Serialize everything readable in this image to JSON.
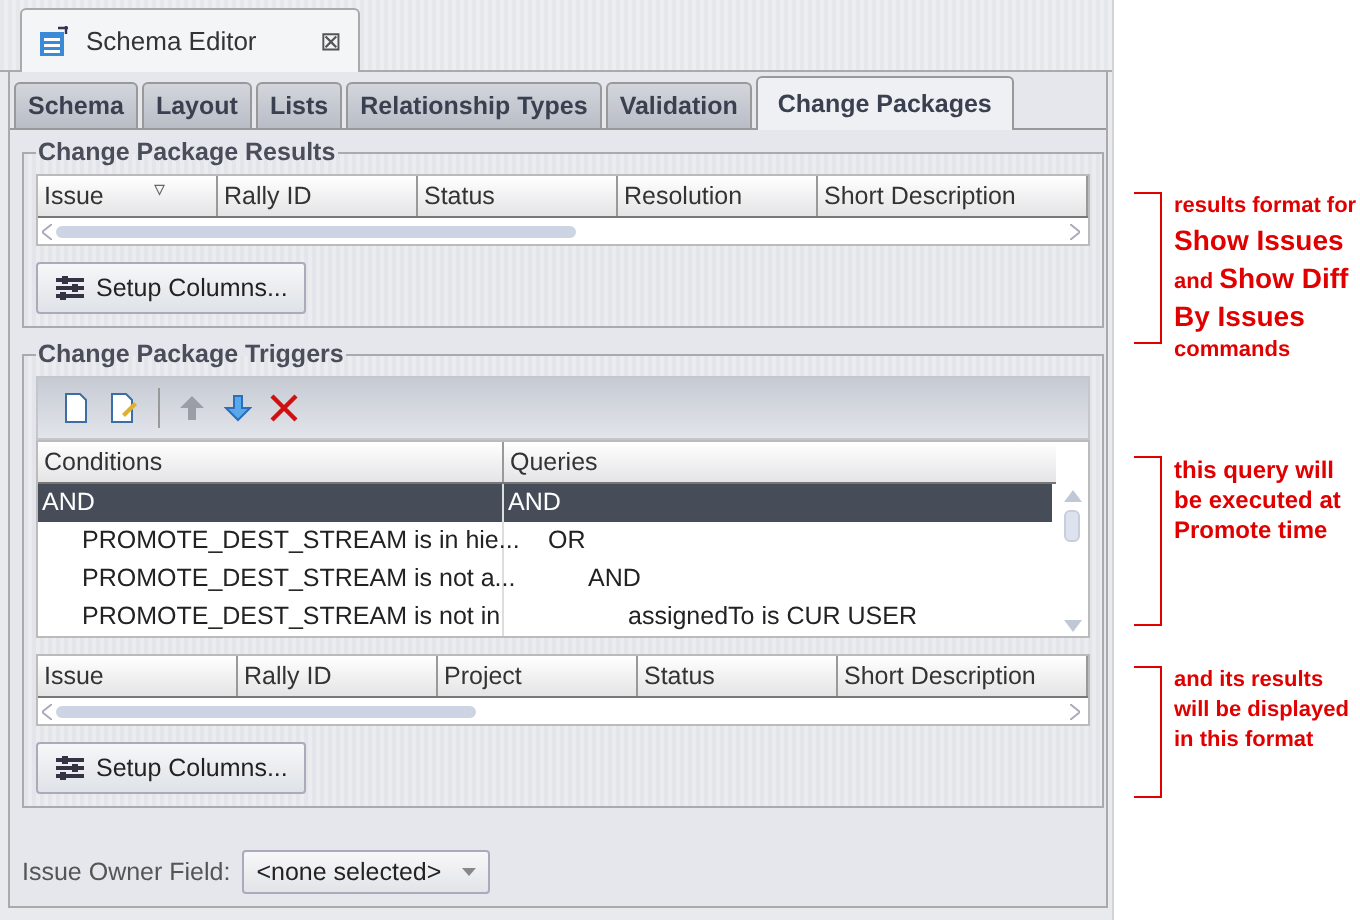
{
  "editor_tab": {
    "title": "Schema Editor",
    "close": "⊠"
  },
  "tabs": [
    {
      "label": "Schema",
      "selected": false
    },
    {
      "label": "Layout",
      "selected": false
    },
    {
      "label": "Lists",
      "selected": false
    },
    {
      "label": "Relationship Types",
      "selected": false
    },
    {
      "label": "Validation",
      "selected": false
    },
    {
      "label": "Change Packages",
      "selected": true
    }
  ],
  "results_group": {
    "title": "Change Package Results",
    "columns": [
      {
        "label": "Issue",
        "sort": "▿"
      },
      {
        "label": "Rally ID"
      },
      {
        "label": "Status"
      },
      {
        "label": "Resolution"
      },
      {
        "label": "Short Description"
      }
    ],
    "button": "Setup Columns..."
  },
  "triggers_group": {
    "title": "Change Package Triggers",
    "tree_columns": [
      "Conditions",
      "Queries"
    ],
    "conditions": [
      {
        "label": "AND",
        "selected": true,
        "children": [
          {
            "label": "PROMOTE_DEST_STREAM is in hie...",
            "selected": false
          },
          {
            "label": "PROMOTE_DEST_STREAM is not a...",
            "selected": false
          },
          {
            "label": "PROMOTE_DEST_STREAM is not in",
            "selected": false
          }
        ]
      }
    ],
    "queries": [
      {
        "label": "AND",
        "selected": true,
        "children": [
          {
            "label": "OR",
            "selected": false,
            "children": [
              {
                "label": "AND",
                "selected": false,
                "children": [
                  {
                    "label": "assignedTo is CUR USER",
                    "selected": false
                  }
                ]
              }
            ]
          }
        ]
      }
    ],
    "columns": [
      {
        "label": "Issue"
      },
      {
        "label": "Rally ID"
      },
      {
        "label": "Project"
      },
      {
        "label": "Status"
      },
      {
        "label": "Short Description"
      }
    ],
    "button": "Setup Columns..."
  },
  "owner_field": {
    "label": "Issue Owner Field:",
    "value": "<none selected>"
  },
  "annotations": [
    "results format for **Show Issues** and **Show Diff By Issues** commands",
    "this query will be executed at Promote time",
    "and its results will be displayed in this format"
  ]
}
